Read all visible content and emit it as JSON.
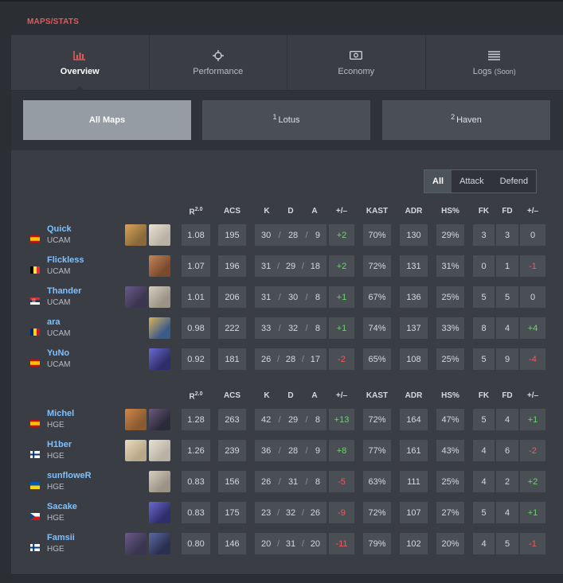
{
  "section_title": "MAPS/STATS",
  "tabs": [
    {
      "label": "Overview",
      "icon": "bar-chart-icon"
    },
    {
      "label": "Performance",
      "icon": "crosshair-icon"
    },
    {
      "label": "Economy",
      "icon": "money-icon"
    },
    {
      "label": "Logs",
      "suffix": "(Soon)",
      "icon": "list-icon"
    }
  ],
  "maps": [
    {
      "num": "",
      "label": "All Maps"
    },
    {
      "num": "1",
      "label": "Lotus"
    },
    {
      "num": "2",
      "label": "Haven"
    }
  ],
  "filter": [
    "All",
    "Attack",
    "Defend"
  ],
  "columns": {
    "rating_base": "R",
    "rating_sup": "2.0",
    "acs": "ACS",
    "k": "K",
    "d": "D",
    "a": "A",
    "pm": "+/–",
    "kast": "KAST",
    "adr": "ADR",
    "hs": "HS%",
    "fk": "FK",
    "fd": "FD",
    "fkpm": "+/–"
  },
  "colors": {
    "accent": "#e45a5a",
    "positive": "#6bd46b",
    "negative": "#ef5b5b",
    "link": "#7fc0ff"
  },
  "teams": [
    {
      "players": [
        {
          "name": "Quick",
          "team": "UCAM",
          "flag": "es",
          "agents": [
            "agent-a",
            "agent-b"
          ],
          "r": "1.08",
          "acs": "195",
          "k": "30",
          "d": "28",
          "a": "9",
          "pm": "+2",
          "kast": "70%",
          "adr": "130",
          "hs": "29%",
          "fk": "3",
          "fd": "3",
          "fkpm": "0"
        },
        {
          "name": "Flickless",
          "team": "UCAM",
          "flag": "be",
          "agents": [
            "agent-c"
          ],
          "r": "1.07",
          "acs": "196",
          "k": "31",
          "d": "29",
          "a": "18",
          "pm": "+2",
          "kast": "72%",
          "adr": "131",
          "hs": "31%",
          "fk": "0",
          "fd": "1",
          "fkpm": "-1"
        },
        {
          "name": "Thander",
          "team": "UCAM",
          "flag": "rs",
          "agents": [
            "agent-d",
            "agent-e"
          ],
          "r": "1.01",
          "acs": "206",
          "k": "31",
          "d": "30",
          "a": "8",
          "pm": "+1",
          "kast": "67%",
          "adr": "136",
          "hs": "25%",
          "fk": "5",
          "fd": "5",
          "fkpm": "0"
        },
        {
          "name": "ara",
          "team": "UCAM",
          "flag": "ro",
          "agents": [
            "agent-f"
          ],
          "r": "0.98",
          "acs": "222",
          "k": "33",
          "d": "32",
          "a": "8",
          "pm": "+1",
          "kast": "74%",
          "adr": "137",
          "hs": "33%",
          "fk": "8",
          "fd": "4",
          "fkpm": "+4"
        },
        {
          "name": "YuNo",
          "team": "UCAM",
          "flag": "es",
          "agents": [
            "agent-g"
          ],
          "r": "0.92",
          "acs": "181",
          "k": "26",
          "d": "28",
          "a": "17",
          "pm": "-2",
          "kast": "65%",
          "adr": "108",
          "hs": "25%",
          "fk": "5",
          "fd": "9",
          "fkpm": "-4"
        }
      ]
    },
    {
      "players": [
        {
          "name": "Michel",
          "team": "HGE",
          "flag": "es",
          "agents": [
            "agent-h",
            "agent-i"
          ],
          "r": "1.28",
          "acs": "263",
          "k": "42",
          "d": "29",
          "a": "8",
          "pm": "+13",
          "kast": "72%",
          "adr": "164",
          "hs": "47%",
          "fk": "5",
          "fd": "4",
          "fkpm": "+1"
        },
        {
          "name": "H1ber",
          "team": "HGE",
          "flag": "fi",
          "agents": [
            "agent-j",
            "agent-b"
          ],
          "r": "1.26",
          "acs": "239",
          "k": "36",
          "d": "28",
          "a": "9",
          "pm": "+8",
          "kast": "77%",
          "adr": "161",
          "hs": "43%",
          "fk": "4",
          "fd": "6",
          "fkpm": "-2"
        },
        {
          "name": "sunfloweR",
          "team": "HGE",
          "flag": "ua",
          "agents": [
            "agent-e"
          ],
          "r": "0.83",
          "acs": "156",
          "k": "26",
          "d": "31",
          "a": "8",
          "pm": "-5",
          "kast": "63%",
          "adr": "111",
          "hs": "25%",
          "fk": "4",
          "fd": "2",
          "fkpm": "+2"
        },
        {
          "name": "Sacake",
          "team": "HGE",
          "flag": "cz",
          "agents": [
            "agent-g"
          ],
          "r": "0.83",
          "acs": "175",
          "k": "23",
          "d": "32",
          "a": "26",
          "pm": "-9",
          "kast": "72%",
          "adr": "107",
          "hs": "27%",
          "fk": "5",
          "fd": "4",
          "fkpm": "+1"
        },
        {
          "name": "Famsii",
          "team": "HGE",
          "flag": "fi",
          "agents": [
            "agent-d",
            "agent-k"
          ],
          "r": "0.80",
          "acs": "146",
          "k": "20",
          "d": "31",
          "a": "20",
          "pm": "-11",
          "kast": "79%",
          "adr": "102",
          "hs": "20%",
          "fk": "4",
          "fd": "5",
          "fkpm": "-1"
        }
      ]
    }
  ]
}
